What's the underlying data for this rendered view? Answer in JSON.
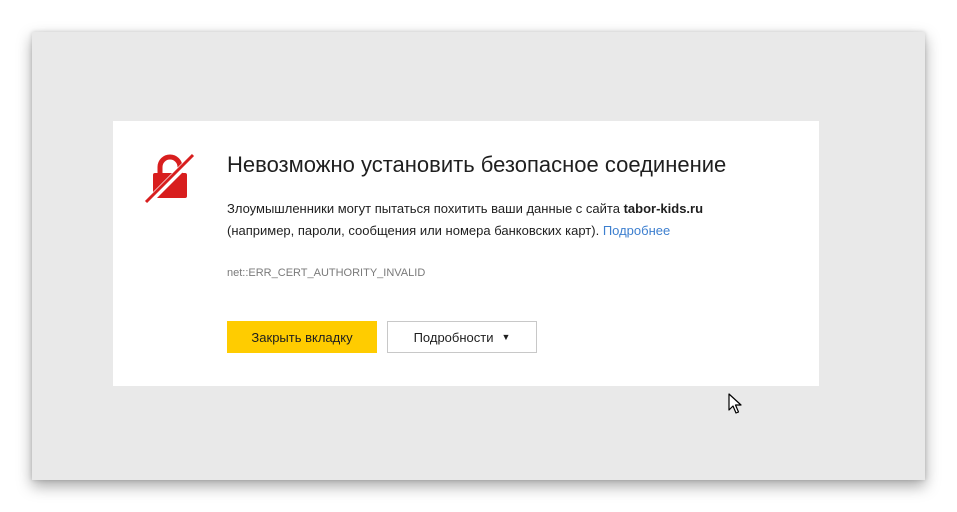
{
  "error_page": {
    "title": "Невозможно установить безопасное соединение",
    "description_prefix": "Злоумышленники могут пытаться похитить ваши данные с сайта ",
    "site": "tabor-kids.ru",
    "description_suffix": "(например, пароли, сообщения или номера банковских карт).",
    "more_link": "Подробнее",
    "error_code": "net::ERR_CERT_AUTHORITY_INVALID",
    "close_tab_button": "Закрыть вкладку",
    "details_button": "Подробности",
    "details_caret": "▼"
  },
  "icons": {
    "warning": "broken-lock-icon",
    "cursor": "mouse-pointer-icon"
  },
  "colors": {
    "accent_button": "#ffcc00",
    "link": "#3d7fcf",
    "warning_icon": "#d81e1e",
    "background": "#e9e9e9"
  }
}
